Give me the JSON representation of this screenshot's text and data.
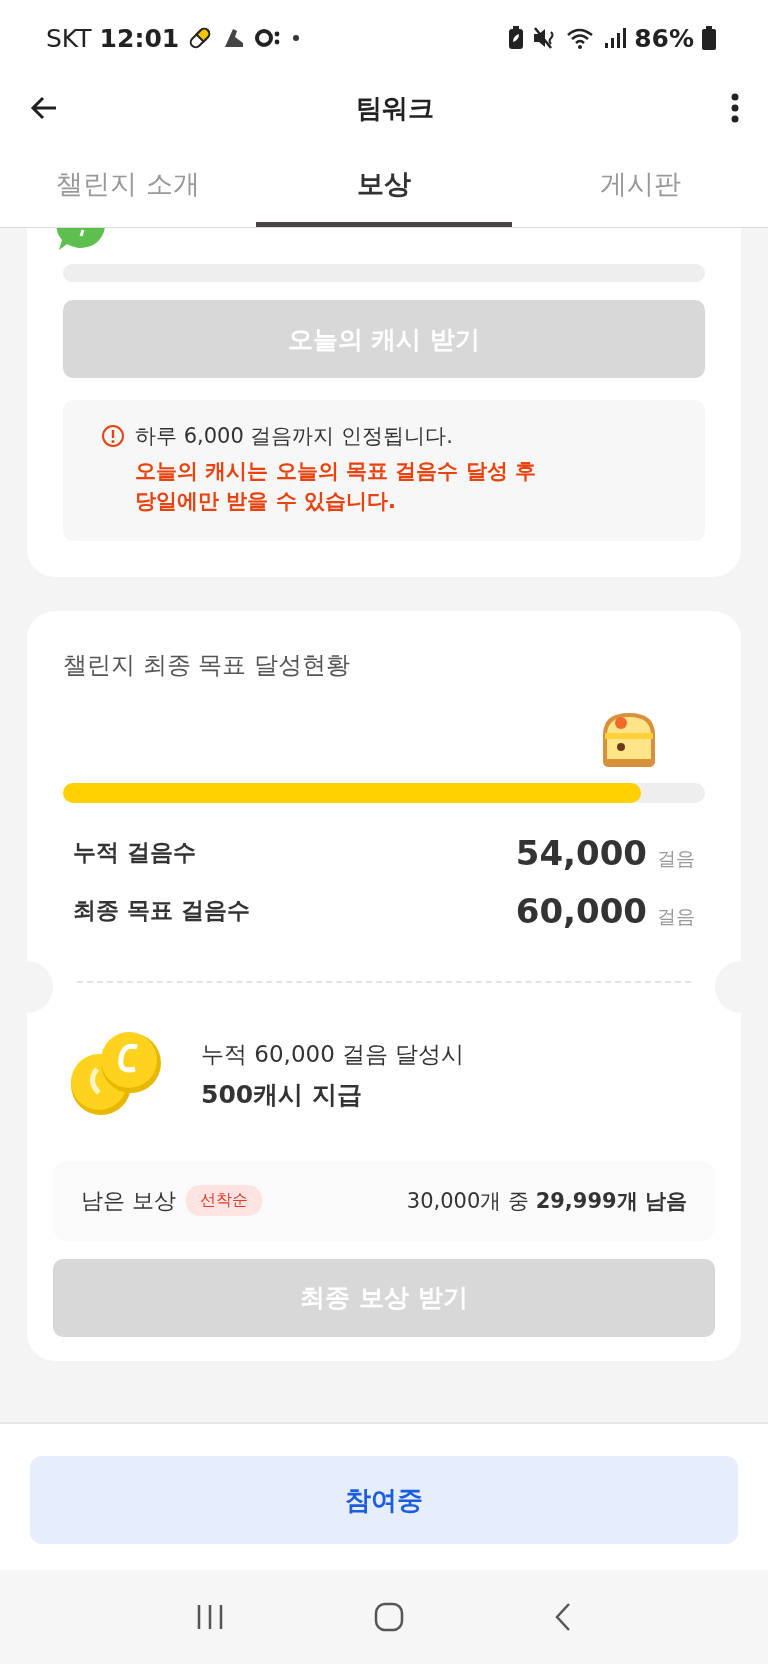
{
  "status_bar": {
    "carrier": "SKT",
    "time": "12:01",
    "battery": "86%"
  },
  "app_bar": {
    "title": "팀워크"
  },
  "tabs": [
    {
      "label": "챌린지 소개",
      "selected": false
    },
    {
      "label": "보상",
      "selected": true
    },
    {
      "label": "게시판",
      "selected": false
    }
  ],
  "daily_card": {
    "button": {
      "label": "오늘의 캐시 받기",
      "disabled": true
    },
    "notice": {
      "info": "하루 6,000 걸음까지 인정됩니다.",
      "warning": "오늘의 캐시는 오늘의 목표 걸음수 달성 후\n당일에만 받을 수 있습니다."
    }
  },
  "final_card": {
    "title": "챌린지 최종 목표 달성현황",
    "progress": {
      "level": 0.9
    },
    "stats": [
      {
        "label": "누적 걸음수",
        "value": "54,000",
        "unit": "걸음"
      },
      {
        "label": "최종 목표 걸음수",
        "value": "60,000",
        "unit": "걸음"
      }
    ],
    "reward": {
      "condition": "누적 60,000 걸음 달성시",
      "amount": "500캐시 지급"
    },
    "remaining": {
      "label": "남은 보상",
      "badge": "선착순",
      "count": "30,000개 중 **29,999개 남음**"
    },
    "button": {
      "label": "최종 보상 받기",
      "disabled": true
    }
  },
  "bottom_button": {
    "label": "참여중"
  }
}
